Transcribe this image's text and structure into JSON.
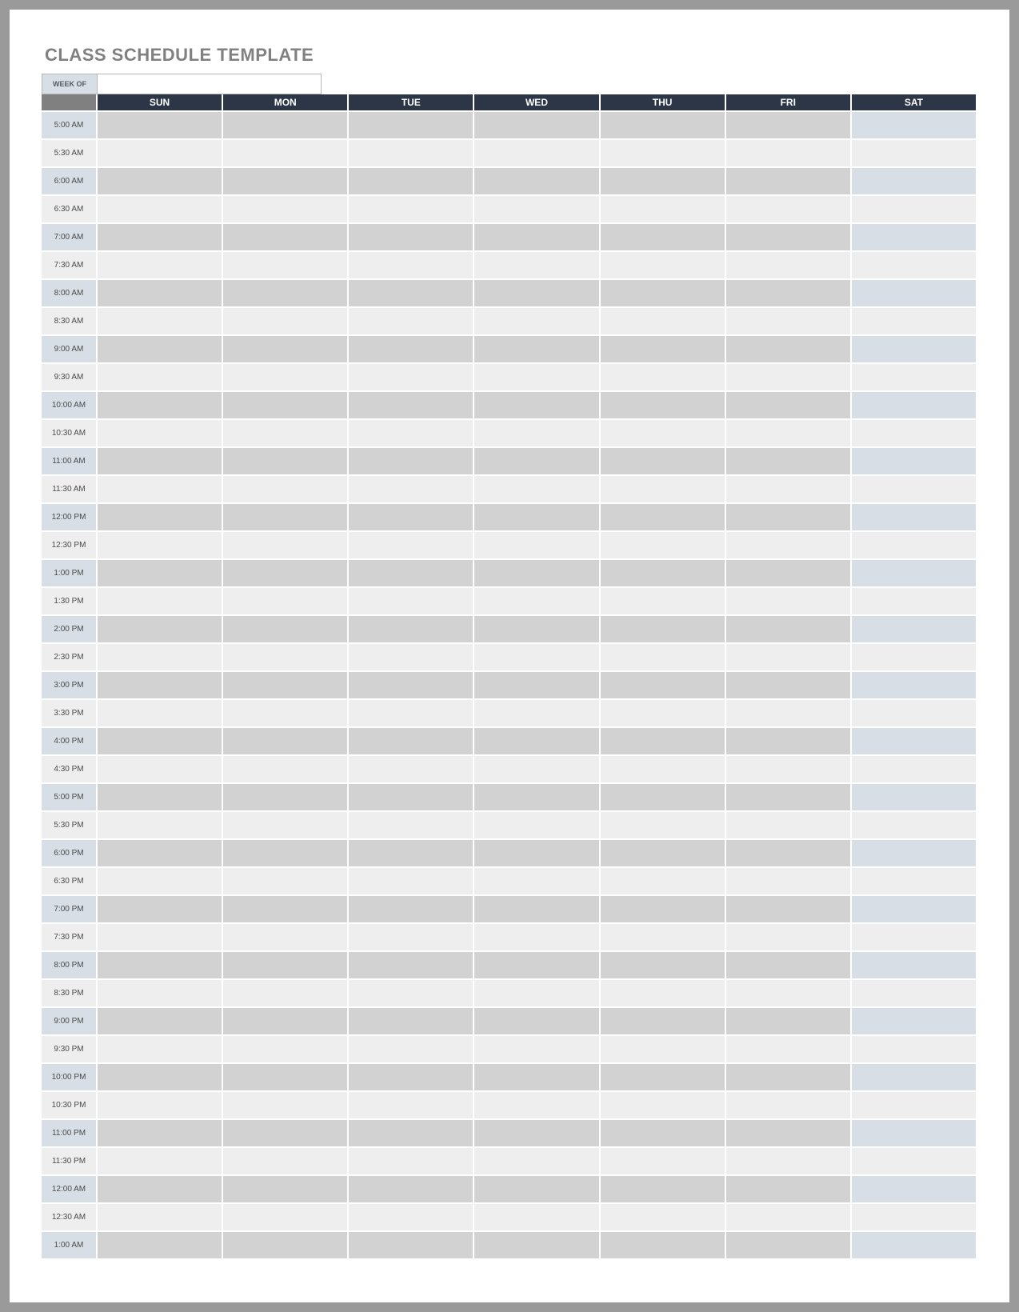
{
  "title": "CLASS SCHEDULE TEMPLATE",
  "weekof_label": "WEEK OF",
  "weekof_value": "",
  "days": [
    "SUN",
    "MON",
    "TUE",
    "WED",
    "THU",
    "FRI",
    "SAT"
  ],
  "times": [
    "5:00 AM",
    "5:30 AM",
    "6:00 AM",
    "6:30 AM",
    "7:00 AM",
    "7:30 AM",
    "8:00 AM",
    "8:30 AM",
    "9:00 AM",
    "9:30 AM",
    "10:00 AM",
    "10:30 AM",
    "11:00 AM",
    "11:30 AM",
    "12:00 PM",
    "12:30 PM",
    "1:00 PM",
    "1:30 PM",
    "2:00 PM",
    "2:30 PM",
    "3:00 PM",
    "3:30 PM",
    "4:00 PM",
    "4:30 PM",
    "5:00 PM",
    "5:30 PM",
    "6:00 PM",
    "6:30 PM",
    "7:00 PM",
    "7:30 PM",
    "8:00 PM",
    "8:30 PM",
    "9:00 PM",
    "9:30 PM",
    "10:00 PM",
    "10:30 PM",
    "11:00 PM",
    "11:30 PM",
    "12:00 AM",
    "12:30 AM",
    "1:00 AM"
  ]
}
